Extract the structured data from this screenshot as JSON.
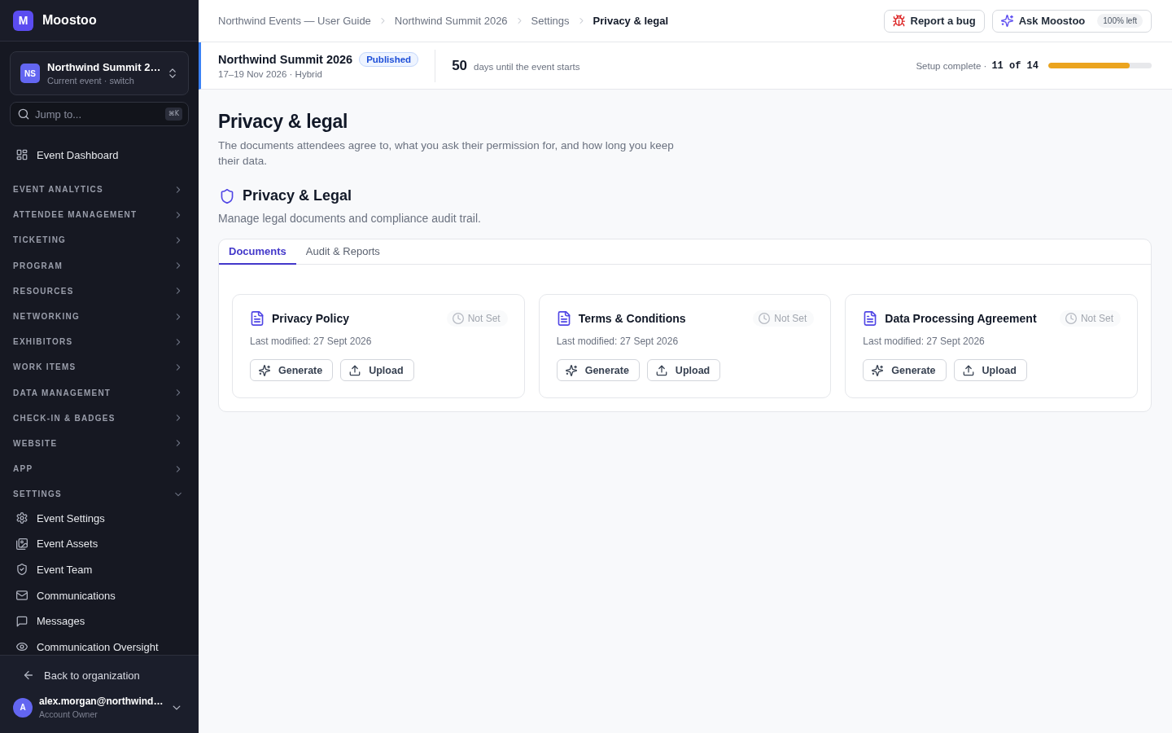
{
  "sidebar": {
    "brand": {
      "logo": "M",
      "name": "Moostoo"
    },
    "event_switcher": {
      "initials": "NS",
      "title": "Northwind Summit 2…",
      "subtitle": "Current event · switch"
    },
    "search": {
      "placeholder": "Jump to...",
      "shortcut": "⌘K"
    },
    "nav": [
      {
        "kind": "link",
        "label": "Event Dashboard"
      },
      {
        "kind": "section",
        "label": "EVENT ANALYTICS",
        "expanded": false
      },
      {
        "kind": "section",
        "label": "ATTENDEE MANAGEMENT",
        "expanded": false
      },
      {
        "kind": "section",
        "label": "TICKETING",
        "expanded": false
      },
      {
        "kind": "section",
        "label": "PROGRAM",
        "expanded": false
      },
      {
        "kind": "section",
        "label": "RESOURCES",
        "expanded": false
      },
      {
        "kind": "section",
        "label": "NETWORKING",
        "expanded": false
      },
      {
        "kind": "section",
        "label": "EXHIBITORS",
        "expanded": false
      },
      {
        "kind": "section",
        "label": "WORK ITEMS",
        "expanded": false
      },
      {
        "kind": "section",
        "label": "DATA MANAGEMENT",
        "expanded": false
      },
      {
        "kind": "section",
        "label": "CHECK-IN & BADGES",
        "expanded": false
      },
      {
        "kind": "section",
        "label": "WEBSITE",
        "expanded": false
      },
      {
        "kind": "section",
        "label": "APP",
        "expanded": false
      },
      {
        "kind": "section",
        "label": "SETTINGS",
        "expanded": true,
        "children": [
          {
            "label": "Event Settings"
          },
          {
            "label": "Event Assets"
          },
          {
            "label": "Event Team"
          },
          {
            "label": "Communications"
          },
          {
            "label": "Messages"
          },
          {
            "label": "Communication Oversight"
          }
        ]
      }
    ],
    "footer": {
      "back": "Back to organization",
      "user": {
        "initial": "A",
        "email": "alex.morgan@northwind…",
        "role": "Account Owner"
      }
    }
  },
  "top_bar": {
    "breadcrumbs": [
      {
        "label": "Northwind Events — User Guide",
        "current": false
      },
      {
        "label": "Northwind Summit 2026",
        "current": false
      },
      {
        "label": "Settings",
        "current": false
      },
      {
        "label": "Privacy & legal",
        "current": true
      }
    ],
    "actions": [
      {
        "kind": "report",
        "label": "Report a bug"
      },
      {
        "kind": "assistant",
        "label": "Ask Moostoo",
        "badge": "100% left"
      }
    ]
  },
  "event": {
    "title": "Northwind Summit 2026",
    "status": "Published",
    "dates": "17–19 Nov 2026 · Hybrid",
    "countdown": {
      "value": "50",
      "label": "days until the event starts"
    },
    "setup": {
      "label": "Setup complete ·",
      "count": "11 of 14",
      "level": 0.79
    }
  },
  "page": {
    "title": "Privacy & legal",
    "description": "The documents attendees agree to, what you ask their permission for, and how long you keep their data.",
    "section": {
      "title": "Privacy & Legal",
      "subtitle": "Manage legal documents and compliance audit trail."
    },
    "tabs": [
      {
        "label": "Documents",
        "selected": true
      },
      {
        "label": "Audit & Reports",
        "selected": false
      }
    ],
    "documents": [
      {
        "title": "Privacy Policy",
        "status": "Not Set",
        "modified": "Last modified: 27 Sept 2026",
        "actions": [
          {
            "kind": "generate",
            "label": "Generate"
          },
          {
            "kind": "upload",
            "label": "Upload"
          }
        ]
      },
      {
        "title": "Terms & Conditions",
        "status": "Not Set",
        "modified": "Last modified: 27 Sept 2026",
        "actions": [
          {
            "kind": "generate",
            "label": "Generate"
          },
          {
            "kind": "upload",
            "label": "Upload"
          }
        ]
      },
      {
        "title": "Data Processing Agreement",
        "status": "Not Set",
        "modified": "Last modified: 27 Sept 2026",
        "actions": [
          {
            "kind": "generate",
            "label": "Generate"
          },
          {
            "kind": "upload",
            "label": "Upload"
          }
        ]
      }
    ]
  }
}
